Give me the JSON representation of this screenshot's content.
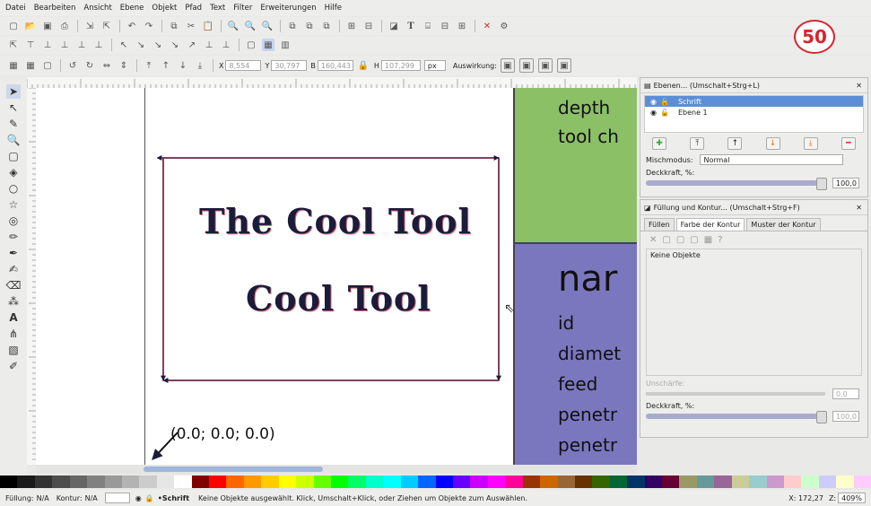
{
  "menubar": [
    "Datei",
    "Bearbeiten",
    "Ansicht",
    "Ebene",
    "Objekt",
    "Pfad",
    "Text",
    "Filter",
    "Erweiterungen",
    "Hilfe"
  ],
  "badge": "50",
  "toolbar3": {
    "x_value": "8,554",
    "y_value": "30,797",
    "w_value": "160,443",
    "h_value": "107,299",
    "unit": "px",
    "affect_label": "Auswirkung:"
  },
  "canvas": {
    "title_line1": "The Cool Tool",
    "title_line2": "Cool Tool",
    "green_lines": [
      "depth",
      "tool ch"
    ],
    "blue_heading": "nar",
    "blue_lines": [
      "id",
      "diamet",
      "feed",
      "penetr",
      "penetr"
    ],
    "coord_label": "(0.0; 0.0; 0.0)"
  },
  "layers_panel": {
    "title": "Ebenen... (Umschalt+Strg+L)",
    "layers": [
      "Schrift",
      "Ebene 1"
    ],
    "blend_label": "Mischmodus:",
    "blend_value": "Normal",
    "opacity_label": "Deckkraft, %:",
    "opacity_value": "100,0"
  },
  "fill_panel": {
    "title": "Füllung und Kontur... (Umschalt+Strg+F)",
    "tabs": [
      "Füllen",
      "Farbe der Kontur",
      "Muster der Kontur"
    ],
    "no_objects": "Keine Objekte",
    "blur_label": "Unschärfe:",
    "blur_value": "0,0",
    "opacity_label": "Deckkraft, %:",
    "opacity_value": "100,0"
  },
  "statusbar": {
    "fill_label": "Füllung:",
    "fill_value": "N/A",
    "stroke_label": "Kontur:",
    "stroke_value": "N/A",
    "layer": "•Schrift",
    "message": "Keine Objekte ausgewählt. Klick, Umschalt+Klick, oder Ziehen um Objekte zum Auswählen.",
    "coords": "X: 172,27",
    "zoom_label": "Z:",
    "zoom_value": "409%"
  },
  "palette_colors": [
    "#000000",
    "#1a1a1a",
    "#333333",
    "#4d4d4d",
    "#666666",
    "#808080",
    "#999999",
    "#b3b3b3",
    "#cccccc",
    "#e6e6e6",
    "#ffffff",
    "#800000",
    "#ff0000",
    "#ff6600",
    "#ff9900",
    "#ffcc00",
    "#ffff00",
    "#ccff00",
    "#66ff00",
    "#00ff00",
    "#00ff66",
    "#00ffcc",
    "#00ffff",
    "#00ccff",
    "#0066ff",
    "#0000ff",
    "#6600ff",
    "#cc00ff",
    "#ff00ff",
    "#ff0099",
    "#993300",
    "#cc6600",
    "#996633",
    "#663300",
    "#336600",
    "#006633",
    "#003366",
    "#330066",
    "#660033",
    "#999966",
    "#669999",
    "#996699",
    "#cccc99",
    "#99cccc",
    "#cc99cc",
    "#ffcccc",
    "#ccffcc",
    "#ccccff",
    "#ffffcc",
    "#ffccff"
  ],
  "colors": {
    "accent": "#d8262e",
    "selection": "#5b8ed6",
    "green_block": "#8cc066",
    "blue_block": "#7b77be"
  }
}
